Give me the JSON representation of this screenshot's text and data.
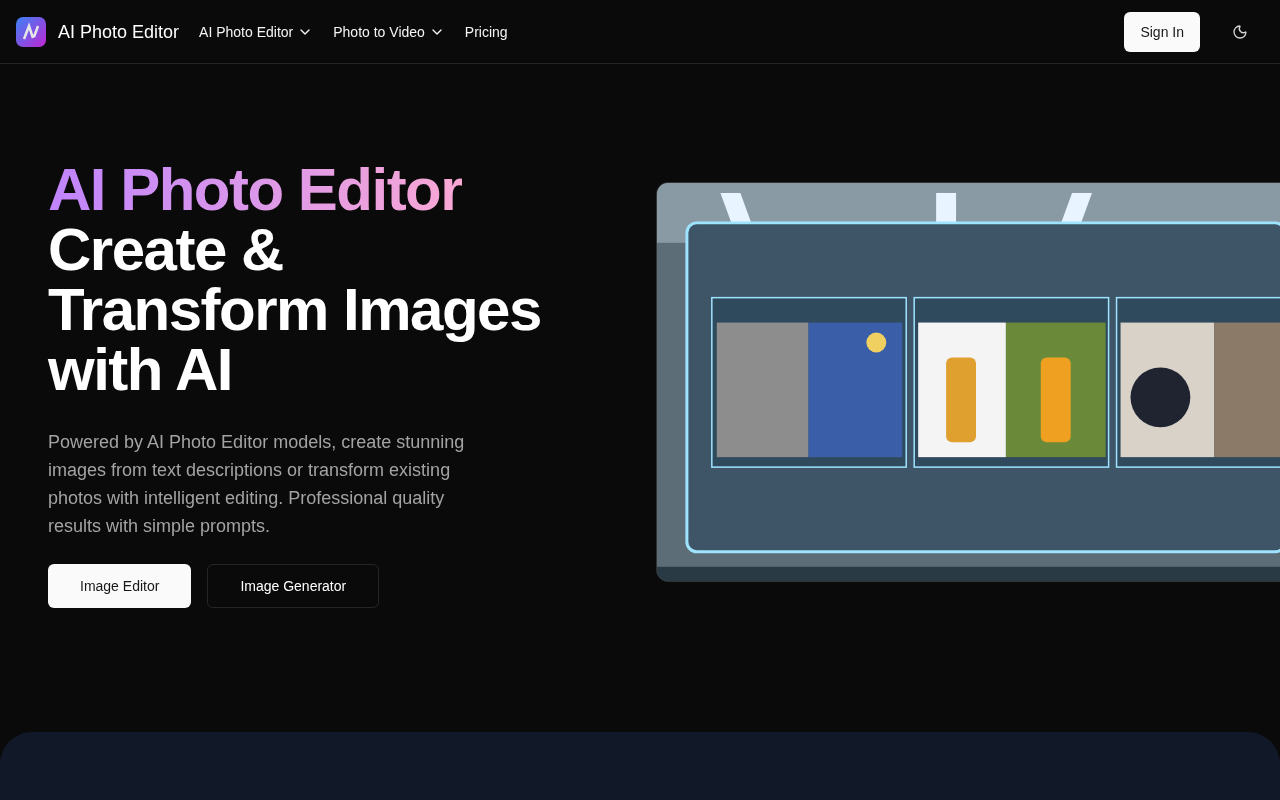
{
  "header": {
    "brand": "AI Photo Editor",
    "nav": [
      {
        "label": "AI Photo Editor",
        "dropdown": true
      },
      {
        "label": "Photo to Video",
        "dropdown": true
      },
      {
        "label": "Pricing",
        "dropdown": false
      }
    ],
    "sign_in": "Sign In"
  },
  "hero": {
    "title_highlight": "AI Photo Editor",
    "title": "Create & Transform Images with AI",
    "description": "Powered by AI Photo Editor models, create stunning images from text descriptions or transform existing photos with intelligent editing. Professional quality results with simple prompts.",
    "buttons": [
      {
        "label": "Image Editor",
        "kind": "primary"
      },
      {
        "label": "Image Generator",
        "kind": "secondary"
      }
    ]
  }
}
